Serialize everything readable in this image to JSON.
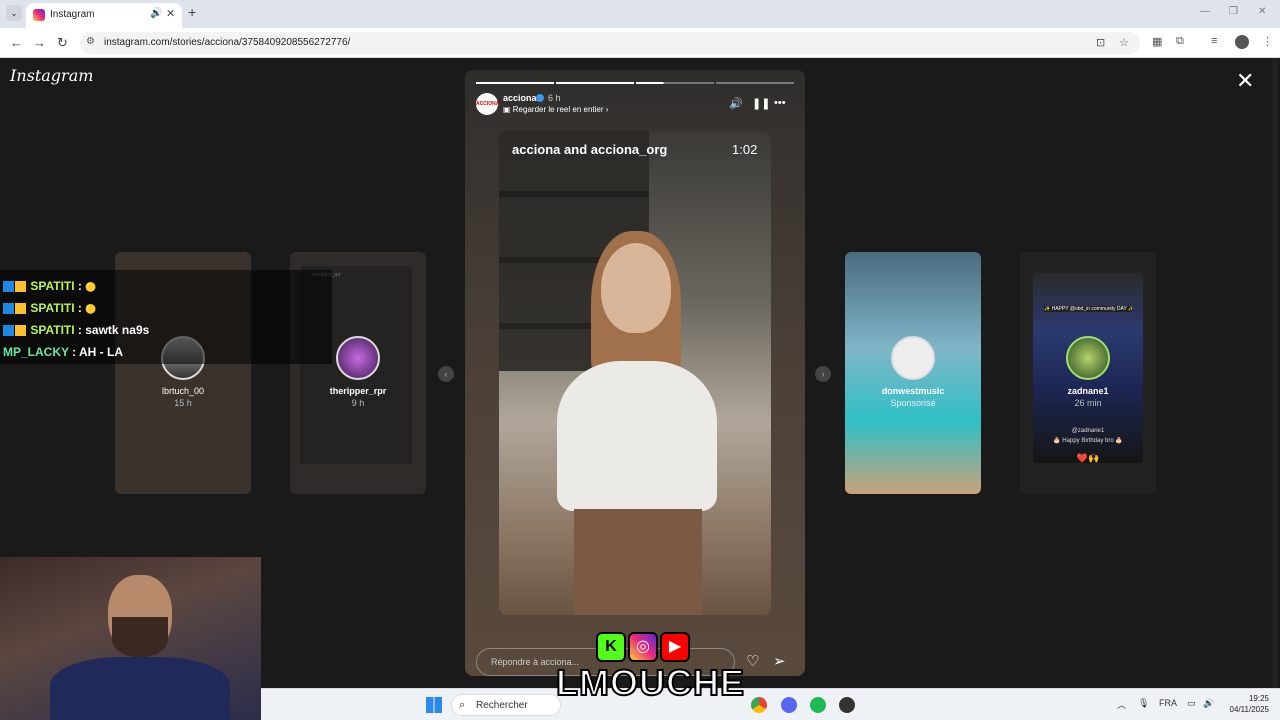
{
  "browser": {
    "tab_title": "Instagram",
    "url": "instagram.com/stories/acciona/3758409208556272776/"
  },
  "app": {
    "logo": "Instagram"
  },
  "story": {
    "username": "acciona",
    "time": "6 h",
    "subtitle": "Regarder le reel en entier",
    "reel_title": "acciona and acciona_org",
    "duration": "1:02",
    "reply_placeholder": "Répondre à acciona...",
    "avatar_text": "ACCIONA"
  },
  "previews": [
    {
      "name": "lbrtuch_00",
      "sub": "15 h",
      "header": "lbrtuch_00"
    },
    {
      "name": "theripper_rpr",
      "sub": "9 h",
      "header": "theripper_rpr"
    },
    {
      "name": "donwestmusic",
      "sub": "Sponsorisé"
    },
    {
      "name": "zadnane1",
      "sub": "26 min",
      "banner": "✨ HAPPY @obd_in community DAY ✨",
      "caption": "@zadnane1",
      "caption2": "🎂 Happy Birthday bro 🎂",
      "emoji": "❤️🙌"
    }
  ],
  "chat": [
    {
      "user": "SPATITI",
      "msg": ""
    },
    {
      "user": "SPATITI",
      "msg": ""
    },
    {
      "user": "SPATITI",
      "msg": "sawtk na9s"
    },
    {
      "user": "MP_LACKY",
      "msg": "AH - LA"
    }
  ],
  "overlay": {
    "brand": "LMOUCHE",
    "kick_letter": "K"
  },
  "taskbar": {
    "search_label": "Rechercher",
    "lang": "FRA",
    "time": "19:25",
    "date": "04/11/2025"
  },
  "colors": {
    "instagram_bg": "#1a1a1a",
    "kick_green": "#53fc18",
    "youtube_red": "#ff0000"
  }
}
